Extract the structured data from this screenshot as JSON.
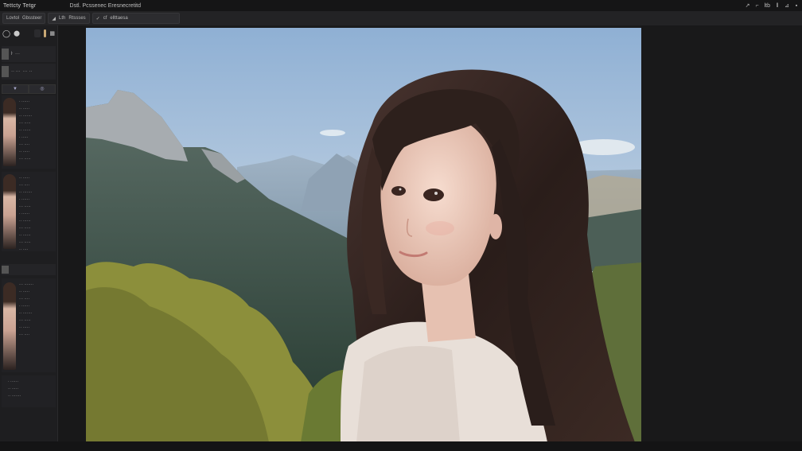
{
  "titlebar": {
    "app_title": "Tettcty Tetgr",
    "doc_title": "Dstl. Pcssenec Eresnecretitd",
    "right_controls": [
      "↗",
      "⌐",
      "ltb",
      "‖",
      "⊿",
      "▪"
    ]
  },
  "toolbar": {
    "group1": [
      "Lovtol",
      "Gbssteer"
    ],
    "group2": [
      "◢",
      "Lth",
      "Rtssses"
    ],
    "group3": [
      "✓",
      "cf",
      "ellttaesa"
    ]
  },
  "sidebar": {
    "rows": [
      {
        "label": "ŀ",
        "sub": "··· "
      },
      {
        "label": "·· ···",
        "sub": "··· ··"
      }
    ],
    "tabs": [
      "▼",
      "◎"
    ],
    "cards": [
      {
        "lines": [
          "· ······",
          "·· ·····",
          "·· ·······",
          "··· ·····",
          "·· ······",
          "· ·····",
          "··· ····",
          "·· ·····",
          "··· ·····"
        ]
      },
      {
        "lines": [
          "·· ·····",
          "··· ····",
          "·· ·······",
          "· ······",
          "··· ·····",
          "· ······",
          "·· ······",
          "··· ·····",
          "·· ······",
          "··· ·····",
          "·· ····"
        ]
      },
      {
        "lines": [
          "··· ·······",
          "·· ·····",
          "··· ····",
          "· ······",
          "·· ·······",
          "··· ·····",
          "·· ·····",
          "··· ····"
        ]
      }
    ]
  },
  "canvas": {
    "colors": {
      "sky_top": "#8fb0d4",
      "sky_bottom": "#dfe6ec",
      "mountain_near": "#40584f",
      "foliage": "#8c8f3b",
      "hair": "#2b1f1c",
      "skin": "#f0d2c5",
      "shirt": "#e8dfd8"
    }
  }
}
